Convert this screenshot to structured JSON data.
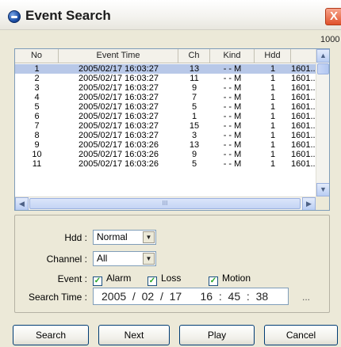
{
  "window": {
    "title": "Event Search",
    "close_glyph": "X"
  },
  "result_count": "1000",
  "list": {
    "columns": [
      "No",
      "Event Time",
      "Ch",
      "Kind",
      "Hdd",
      ""
    ],
    "rows": [
      [
        "1",
        "2005/02/17  16:03:27",
        "13",
        "- - M",
        "1",
        "1601..."
      ],
      [
        "2",
        "2005/02/17  16:03:27",
        "11",
        "- - M",
        "1",
        "1601..."
      ],
      [
        "3",
        "2005/02/17  16:03:27",
        "9",
        "- - M",
        "1",
        "1601..."
      ],
      [
        "4",
        "2005/02/17  16:03:27",
        "7",
        "- - M",
        "1",
        "1601..."
      ],
      [
        "5",
        "2005/02/17  16:03:27",
        "5",
        "- - M",
        "1",
        "1601..."
      ],
      [
        "6",
        "2005/02/17  16:03:27",
        "1",
        "- - M",
        "1",
        "1601..."
      ],
      [
        "7",
        "2005/02/17  16:03:27",
        "15",
        "- - M",
        "1",
        "1601..."
      ],
      [
        "8",
        "2005/02/17  16:03:27",
        "3",
        "- - M",
        "1",
        "1601..."
      ],
      [
        "9",
        "2005/02/17  16:03:26",
        "13",
        "- - M",
        "1",
        "1601..."
      ],
      [
        "10",
        "2005/02/17  16:03:26",
        "9",
        "- - M",
        "1",
        "1601..."
      ],
      [
        "11",
        "2005/02/17  16:03:26",
        "5",
        "- - M",
        "1",
        "1601..."
      ]
    ],
    "selected_row": 0
  },
  "scrollbar": {
    "up_glyph": "▲",
    "down_glyph": "▼",
    "left_glyph": "◀",
    "right_glyph": "▶",
    "thumb_grip": "III"
  },
  "filters": {
    "hdd": {
      "label": "Hdd :",
      "value": "Normal"
    },
    "channel": {
      "label": "Channel :",
      "value": "All"
    },
    "event": {
      "label": "Event :",
      "options": [
        {
          "label": "Alarm",
          "checked": true
        },
        {
          "label": "Loss",
          "checked": true
        },
        {
          "label": "Motion",
          "checked": true
        }
      ]
    },
    "search_time": {
      "label": "Search Time :",
      "value": "2005  /  02  /  17      16  :  45  :  38",
      "more": "..."
    }
  },
  "combo_arrow_glyph": "▼",
  "check_glyph": "✓",
  "buttons": {
    "search": "Search",
    "next": "Next",
    "play": "Play",
    "cancel": "Cancel"
  }
}
